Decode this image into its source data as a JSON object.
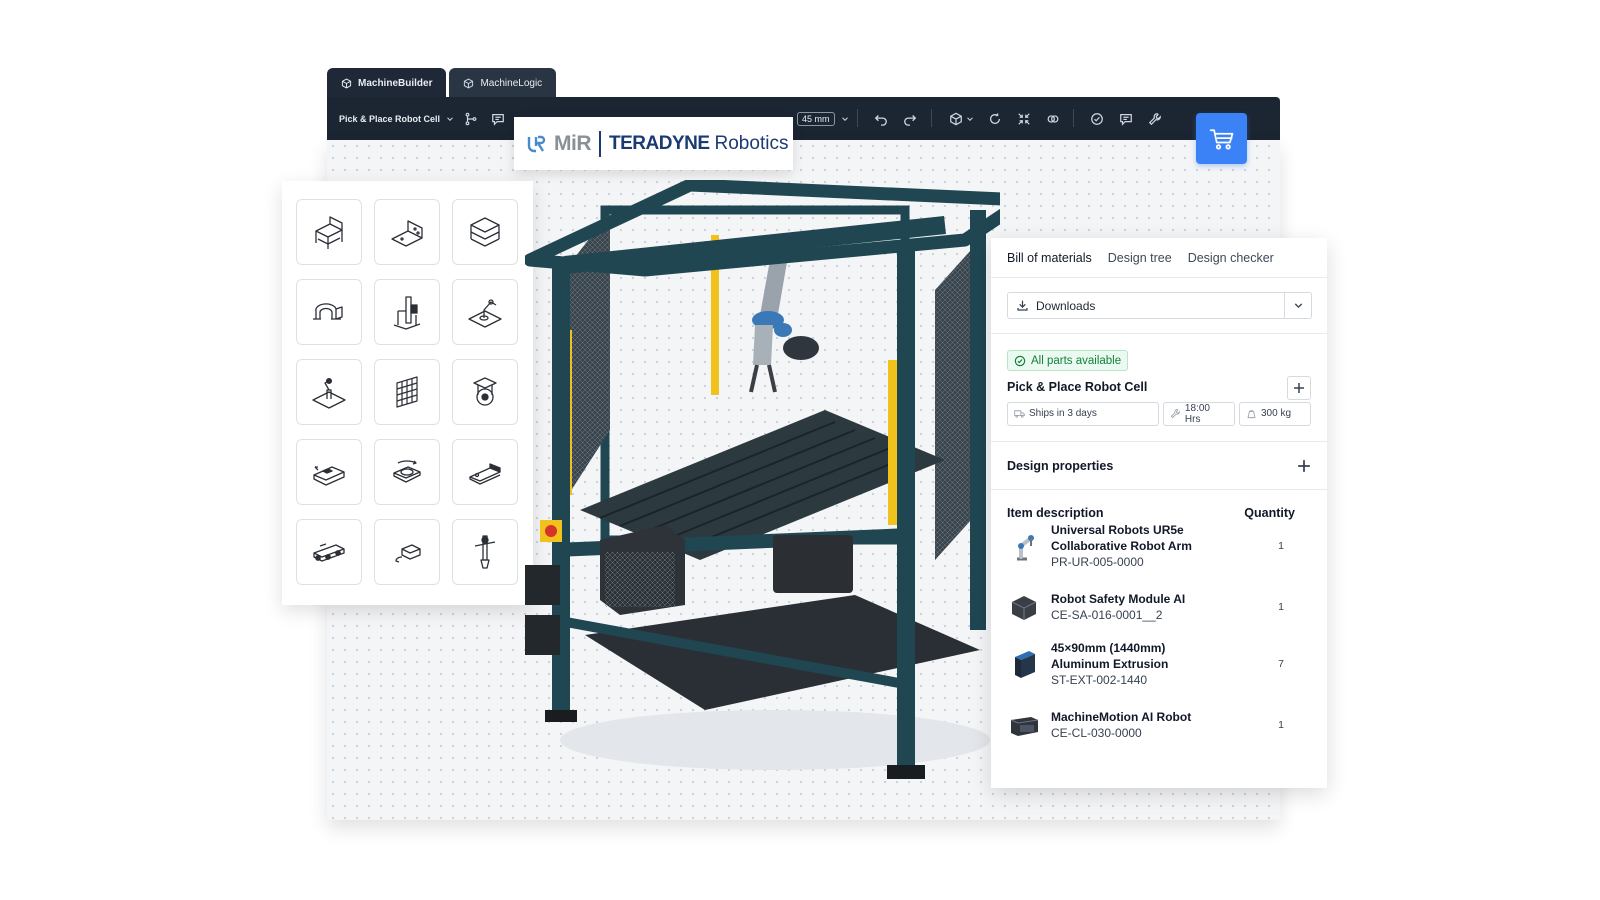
{
  "tabs": [
    {
      "label": "MachineBuilder",
      "icon": "cube-icon",
      "active": true
    },
    {
      "label": "MachineLogic",
      "icon": "cube-icon",
      "active": false
    }
  ],
  "toolbar": {
    "project_name": "Pick & Place Robot Cell",
    "increment": "45 mm"
  },
  "brand": {
    "mir": "MiR",
    "teradyne": "TERADYNE",
    "robotics": "Robotics",
    "navy": "#1b3a73"
  },
  "library": {
    "items": [
      "workbench-icon",
      "angle-bracket-icon",
      "plates-stack-icon",
      "handle-bracket-icon",
      "column-mount-icon",
      "robot-on-plate-icon",
      "robot-arm-base-icon",
      "mesh-panel-icon",
      "caster-wheel-icon",
      "linear-actuator-icon",
      "rotary-table-icon",
      "belt-actuator-icon",
      "conveyor-icon",
      "sensor-block-icon",
      "gripper-tool-icon"
    ]
  },
  "bom": {
    "tabs": [
      "Bill of materials",
      "Design tree",
      "Design checker"
    ],
    "downloads_label": "Downloads",
    "availability": "All parts available",
    "cell_title": "Pick & Place Robot Cell",
    "ships": "Ships in 3 days",
    "hours": "18:00 Hrs",
    "weight": "300 kg",
    "design_properties": "Design properties",
    "col_description": "Item description",
    "col_quantity": "Quantity",
    "items": [
      {
        "name_line1": "Universal Robots UR5e",
        "name_line2": "Collaborative Robot Arm",
        "code": "PR-UR-005-0000",
        "qty": "1",
        "icon": "robot-arm-icon"
      },
      {
        "name_line1": "Robot Safety Module AI",
        "name_line2": "",
        "code": "CE-SA-016-0001__2",
        "qty": "1",
        "icon": "safety-module-icon"
      },
      {
        "name_line1": "45×90mm (1440mm)",
        "name_line2": "Aluminum Extrusion",
        "code": "ST-EXT-002-1440",
        "qty": "7",
        "icon": "extrusion-icon"
      },
      {
        "name_line1": "MachineMotion AI Robot",
        "name_line2": "",
        "code": "CE-CL-030-0000",
        "qty": "1",
        "icon": "controller-icon"
      }
    ]
  },
  "colors": {
    "accent": "#3b82f6",
    "toolbar": "#1c2532",
    "frame": "#1f4651",
    "available_green": "#15803d"
  }
}
